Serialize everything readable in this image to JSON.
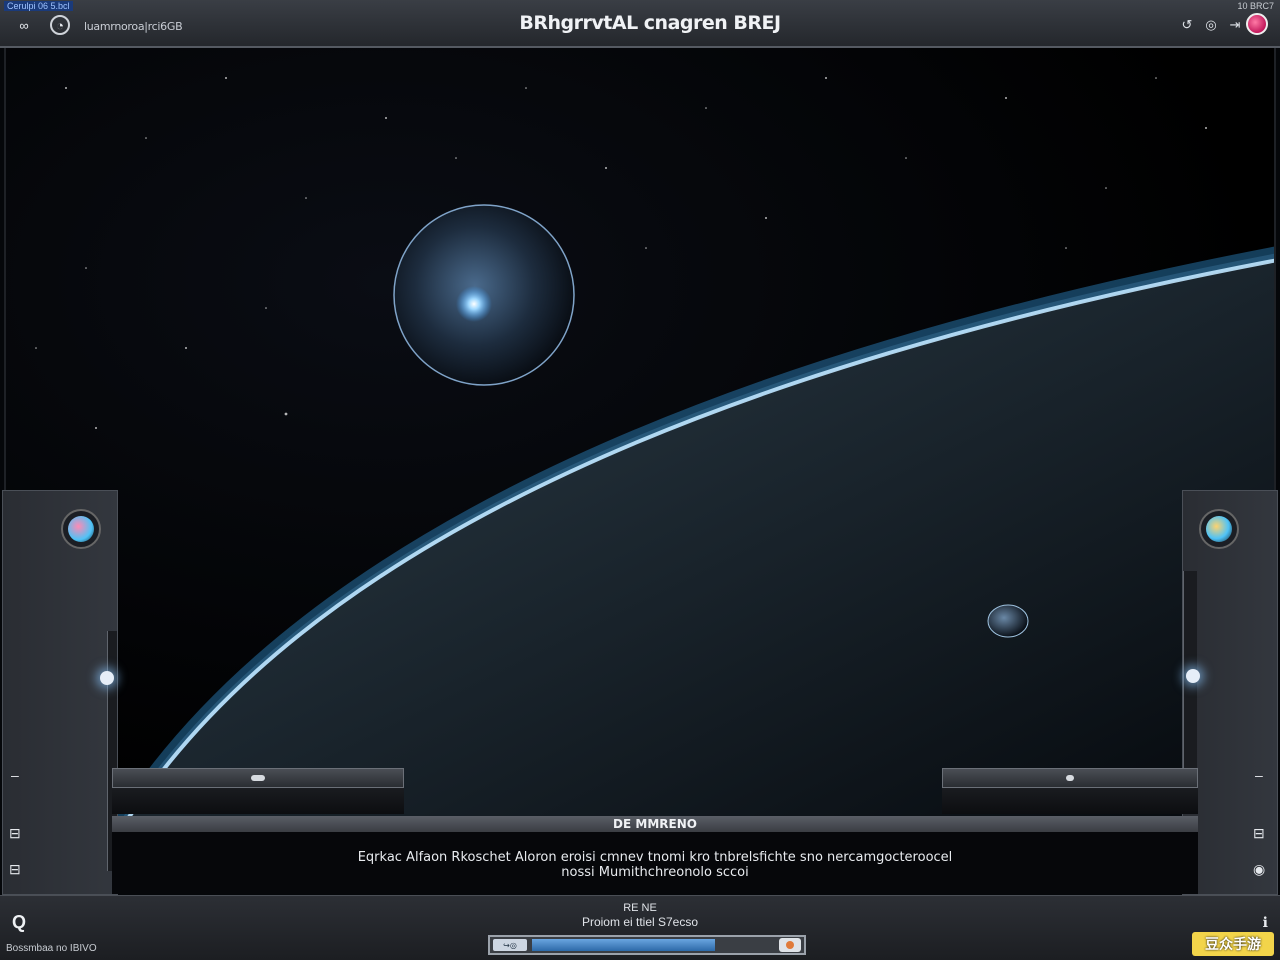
{
  "window": {
    "corner_label": "Cerulpi 06 5.bcl",
    "corner_right": "10 BRC7",
    "title": "BRhgrrvtAL cnagren BREJ",
    "subtitle": "luamrnoroa|rci6GB"
  },
  "toolbar_left": [
    {
      "icon": "link-icon",
      "glyph": "∞"
    },
    {
      "icon": "refresh-icon",
      "glyph": "◔"
    }
  ],
  "toolbar_right": [
    {
      "icon": "undo-icon",
      "glyph": "↺"
    },
    {
      "icon": "sync-icon",
      "glyph": "◎"
    },
    {
      "icon": "export-icon",
      "glyph": "⇥"
    }
  ],
  "info_panel": {
    "heading": "DE MMRENO",
    "line1": "Eqrkac Alfaon  Rkoschet  Aloron eroisi cmnev  tnomi  kro tnbrelsfichte sno nercamgocteroocel",
    "line2": "nossi  Mumithchreonolo sccoi"
  },
  "status_bar": {
    "left_text": "Bossmbaa no IBIVO",
    "center_line1": "RE NE",
    "center_line2": "Proiom  ei  ttiel  S7ecso",
    "progress_pct": 75,
    "progress_label": "↪◎"
  },
  "brand_badge": "豆众手游",
  "colors": {
    "atmosphere": "#3ab0ff",
    "accent_red": "#c2185b",
    "progress": "#2d6aa8"
  }
}
